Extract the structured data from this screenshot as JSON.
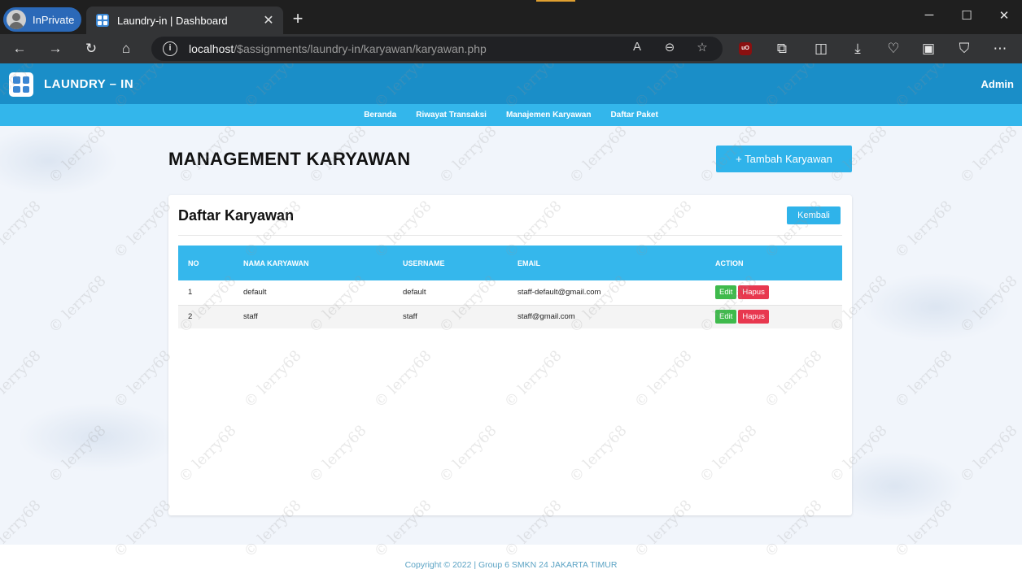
{
  "browser": {
    "inprivate_label": "InPrivate",
    "tab_title": "Laundry-in | Dashboard",
    "url_host": "localhost",
    "url_path": "/$assignments/laundry-in/karyawan/karyawan.php",
    "icons": [
      "back-icon",
      "forward-icon",
      "refresh-icon",
      "home-icon",
      "info-icon",
      "read-aloud-icon",
      "zoom-icon",
      "favorite-star-icon",
      "ublock-icon",
      "extensions-icon",
      "split-screen-icon",
      "downloads-icon",
      "health-icon",
      "screenshot-icon",
      "shield-icon",
      "more-icon"
    ]
  },
  "app": {
    "brand": "LAUNDRY – IN",
    "user": "Admin",
    "accent_color": "#1a8ec8",
    "nav": [
      {
        "label": "Beranda"
      },
      {
        "label": "Riwayat Transaksi"
      },
      {
        "label": "Manajemen Karyawan"
      },
      {
        "label": "Daftar Paket"
      }
    ]
  },
  "main": {
    "title": "MANAGEMENT KARYAWAN",
    "add_button": "+ Tambah Karyawan",
    "card_title": "Daftar Karyawan",
    "back_button": "Kembali",
    "columns": [
      "NO",
      "NAMA KARYAWAN",
      "USERNAME",
      "EMAIL",
      "ACTION"
    ],
    "rows": [
      {
        "no": "1",
        "nama": "default",
        "username": "default",
        "email": "staff-default@gmail.com"
      },
      {
        "no": "2",
        "nama": "staff",
        "username": "staff",
        "email": "staff@gmail.com"
      }
    ],
    "edit_label": "Edit",
    "delete_label": "Hapus"
  },
  "footer": {
    "text": "Copyright © 2022 | Group 6 SMKN 24 JAKARTA TIMUR"
  },
  "watermark": "© lerry68"
}
